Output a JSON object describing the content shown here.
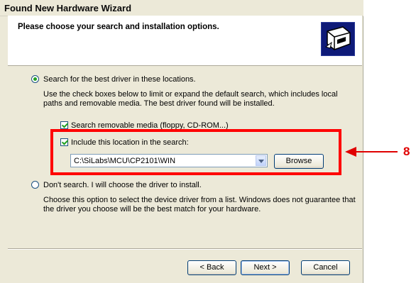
{
  "window": {
    "title": "Found New Hardware Wizard"
  },
  "header": {
    "heading": "Please choose your search and installation options.",
    "icon": "hardware-wizard-icon"
  },
  "options": {
    "search_radio": {
      "label": "Search for the best driver in these locations.",
      "checked": true
    },
    "search_description": "Use the check boxes below to limit or expand the default search, which includes local paths and removable media. The best driver found will be installed.",
    "removable_media": {
      "label": "Search removable media (floppy, CD-ROM...)",
      "checked": true
    },
    "include_location": {
      "label": "Include this location in the search:",
      "checked": true
    },
    "location_combo": {
      "value": "C:\\SiLabs\\MCU\\CP2101\\WIN"
    },
    "browse_label": "Browse",
    "dont_search_radio": {
      "label": "Don't search. I will choose the driver to install.",
      "checked": false
    },
    "dont_search_description": "Choose this option to select the device driver from a list.  Windows does not guarantee that the driver you choose will be the best match for your hardware."
  },
  "footer": {
    "back_label": "< Back",
    "next_label": "Next >",
    "cancel_label": "Cancel"
  },
  "annotation": {
    "number": "8",
    "color": "#ff0000"
  },
  "colors": {
    "dialog_bg": "#ece9d8",
    "accent": "#21a121",
    "highlight": "#ff0000"
  }
}
